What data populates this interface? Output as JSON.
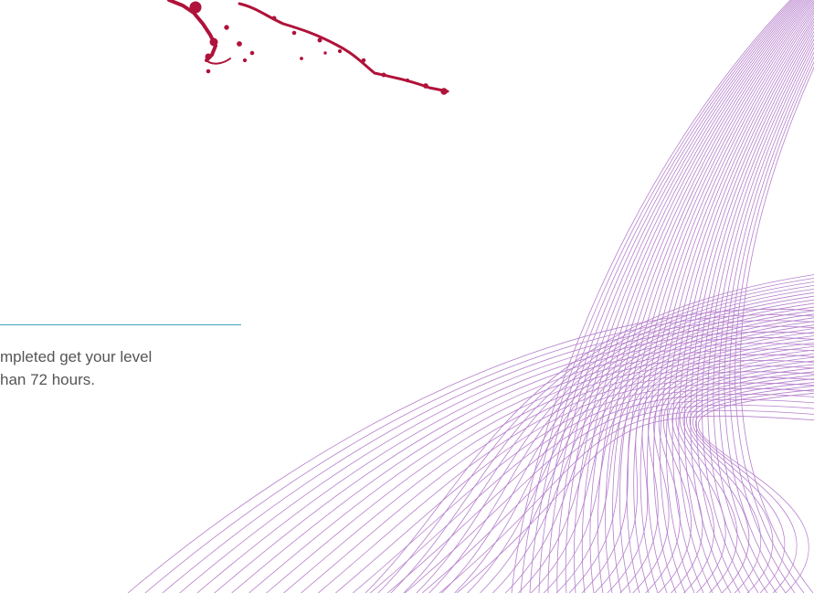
{
  "content": {
    "info_text": "mpleted get your level\nhan 72 hours."
  },
  "colors": {
    "accent_line": "#3fa6b8",
    "text": "#555555",
    "splash": "#b0123a",
    "line_art": "#b57fcc"
  },
  "graphics": {
    "splash_image": "red-ink-splash",
    "line_art_image": "purple-line-waves"
  }
}
